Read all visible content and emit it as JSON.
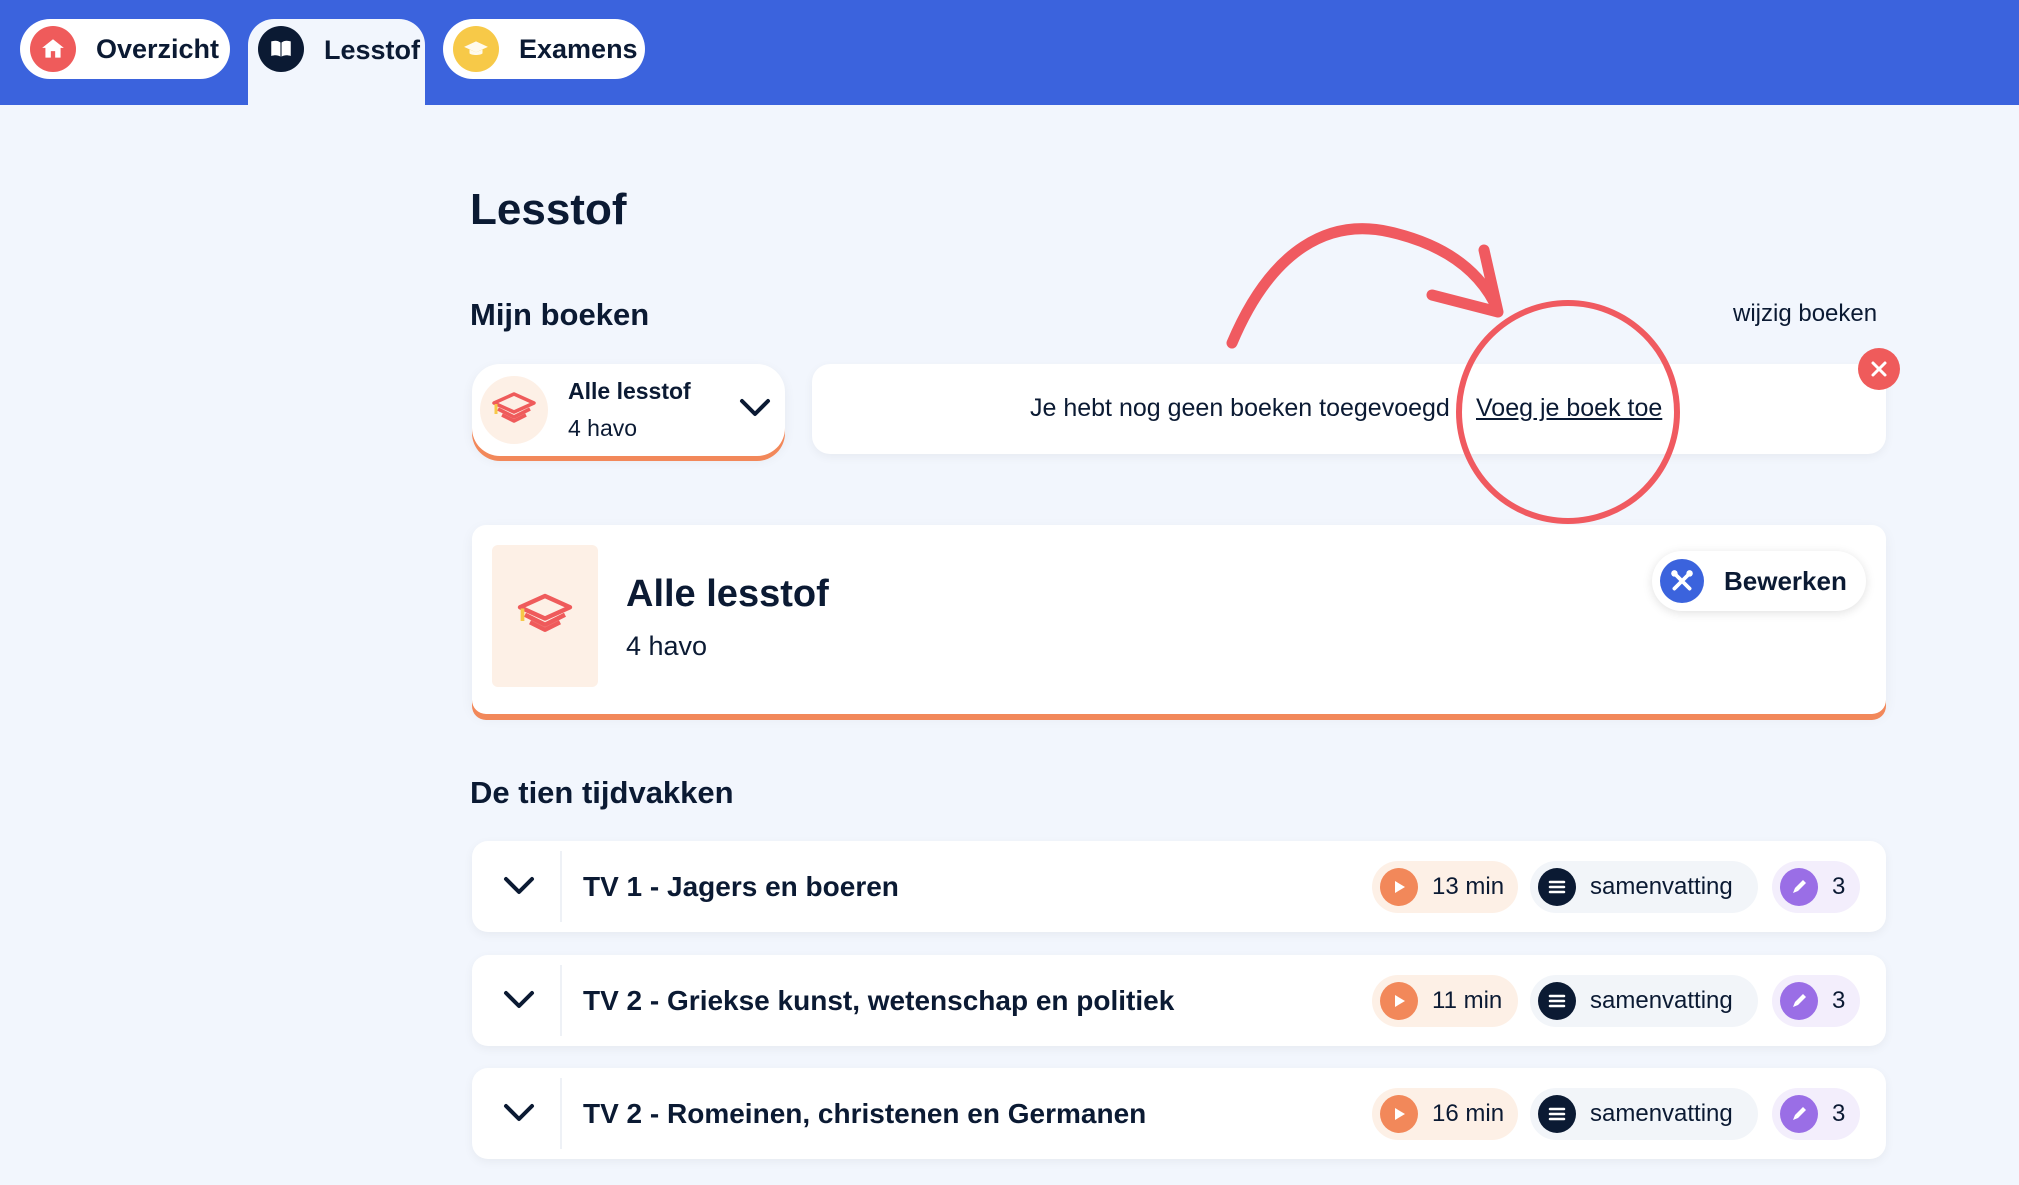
{
  "nav": {
    "tabs": [
      {
        "label": "Overzicht",
        "icon": "home-icon",
        "color": "#ef5b5b"
      },
      {
        "label": "Lesstof",
        "icon": "book-icon",
        "color": "#0b1a33"
      },
      {
        "label": "Examens",
        "icon": "graduation-cap-icon",
        "color": "#f7c948"
      }
    ],
    "active": "Lesstof"
  },
  "page": {
    "title": "Lesstof",
    "my_books_heading": "Mijn boeken",
    "edit_books_link": "wijzig boeken"
  },
  "book_select": {
    "title": "Alle lesstof",
    "subtitle": "4 havo",
    "icon": "graduation-cap-icon"
  },
  "notice": {
    "message": "Je hebt nog geen boeken toegevoegd",
    "link": "Voeg je boek toe",
    "close_icon": "close-icon"
  },
  "current": {
    "title": "Alle lesstof",
    "subtitle": "4 havo",
    "edit_label": "Bewerken",
    "edit_icon": "tools-icon"
  },
  "section": {
    "heading": "De tien tijdvakken",
    "rows": [
      {
        "title": "TV 1 - Jagers en boeren",
        "time": "13 min",
        "summary": "samenvatting",
        "quizzes": "3"
      },
      {
        "title": "TV 2 - Griekse kunst, wetenschap en politiek",
        "time": "11 min",
        "summary": "samenvatting",
        "quizzes": "3"
      },
      {
        "title": "TV 2 - Romeinen, christenen en Germanen",
        "time": "16 min",
        "summary": "samenvatting",
        "quizzes": "3"
      }
    ]
  },
  "colors": {
    "brand_blue": "#3b63dd",
    "accent_orange": "#f2885a",
    "annotation_red": "#f05a60",
    "background": "#f2f6fd"
  }
}
